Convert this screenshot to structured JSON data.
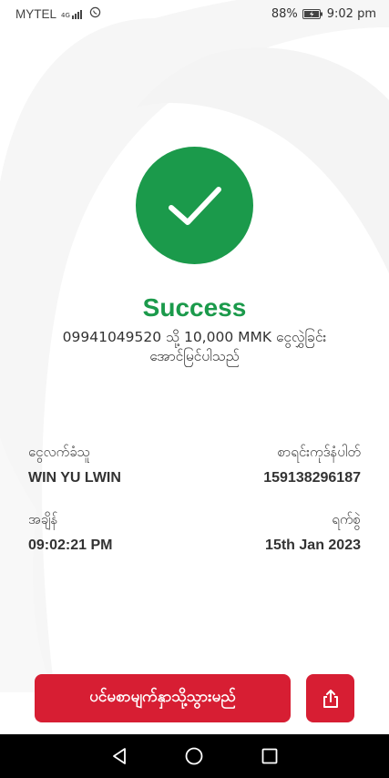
{
  "status_bar": {
    "carrier": "MYTEL",
    "network": "4G",
    "battery": "88%",
    "time": "9:02 pm"
  },
  "result": {
    "title": "Success",
    "message": "09941049520 သို့ 10,000 MMK ငွေလွှဲခြင်း အောင်မြင်ပါသည်"
  },
  "details": {
    "receiver_label": "ငွေလက်ခံသူ",
    "receiver_value": "WIN YU LWIN",
    "transaction_label": "စာရင်းကုဒ်နံပါတ်",
    "transaction_value": "159138296187",
    "time_label": "အချိန်",
    "time_value": "09:02:21 PM",
    "date_label": "ရက်စွဲ",
    "date_value": "15th Jan 2023"
  },
  "actions": {
    "primary_label": "ပင်မစာမျက်နှာသို့သွားမည်",
    "share_icon": "share-icon"
  },
  "colors": {
    "success": "#1b9a4b",
    "primary": "#d71e33"
  }
}
